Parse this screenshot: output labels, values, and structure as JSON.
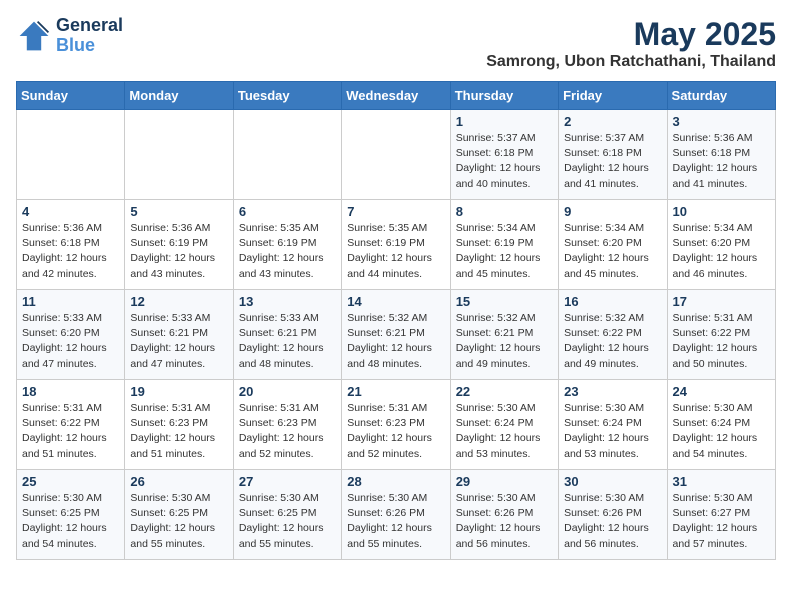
{
  "header": {
    "logo_line1": "General",
    "logo_line2": "Blue",
    "title": "May 2025",
    "subtitle": "Samrong, Ubon Ratchathani, Thailand"
  },
  "days_of_week": [
    "Sunday",
    "Monday",
    "Tuesday",
    "Wednesday",
    "Thursday",
    "Friday",
    "Saturday"
  ],
  "weeks": [
    [
      {
        "day": "",
        "info": ""
      },
      {
        "day": "",
        "info": ""
      },
      {
        "day": "",
        "info": ""
      },
      {
        "day": "",
        "info": ""
      },
      {
        "day": "1",
        "info": "Sunrise: 5:37 AM\nSunset: 6:18 PM\nDaylight: 12 hours\nand 40 minutes."
      },
      {
        "day": "2",
        "info": "Sunrise: 5:37 AM\nSunset: 6:18 PM\nDaylight: 12 hours\nand 41 minutes."
      },
      {
        "day": "3",
        "info": "Sunrise: 5:36 AM\nSunset: 6:18 PM\nDaylight: 12 hours\nand 41 minutes."
      }
    ],
    [
      {
        "day": "4",
        "info": "Sunrise: 5:36 AM\nSunset: 6:18 PM\nDaylight: 12 hours\nand 42 minutes."
      },
      {
        "day": "5",
        "info": "Sunrise: 5:36 AM\nSunset: 6:19 PM\nDaylight: 12 hours\nand 43 minutes."
      },
      {
        "day": "6",
        "info": "Sunrise: 5:35 AM\nSunset: 6:19 PM\nDaylight: 12 hours\nand 43 minutes."
      },
      {
        "day": "7",
        "info": "Sunrise: 5:35 AM\nSunset: 6:19 PM\nDaylight: 12 hours\nand 44 minutes."
      },
      {
        "day": "8",
        "info": "Sunrise: 5:34 AM\nSunset: 6:19 PM\nDaylight: 12 hours\nand 45 minutes."
      },
      {
        "day": "9",
        "info": "Sunrise: 5:34 AM\nSunset: 6:20 PM\nDaylight: 12 hours\nand 45 minutes."
      },
      {
        "day": "10",
        "info": "Sunrise: 5:34 AM\nSunset: 6:20 PM\nDaylight: 12 hours\nand 46 minutes."
      }
    ],
    [
      {
        "day": "11",
        "info": "Sunrise: 5:33 AM\nSunset: 6:20 PM\nDaylight: 12 hours\nand 47 minutes."
      },
      {
        "day": "12",
        "info": "Sunrise: 5:33 AM\nSunset: 6:21 PM\nDaylight: 12 hours\nand 47 minutes."
      },
      {
        "day": "13",
        "info": "Sunrise: 5:33 AM\nSunset: 6:21 PM\nDaylight: 12 hours\nand 48 minutes."
      },
      {
        "day": "14",
        "info": "Sunrise: 5:32 AM\nSunset: 6:21 PM\nDaylight: 12 hours\nand 48 minutes."
      },
      {
        "day": "15",
        "info": "Sunrise: 5:32 AM\nSunset: 6:21 PM\nDaylight: 12 hours\nand 49 minutes."
      },
      {
        "day": "16",
        "info": "Sunrise: 5:32 AM\nSunset: 6:22 PM\nDaylight: 12 hours\nand 49 minutes."
      },
      {
        "day": "17",
        "info": "Sunrise: 5:31 AM\nSunset: 6:22 PM\nDaylight: 12 hours\nand 50 minutes."
      }
    ],
    [
      {
        "day": "18",
        "info": "Sunrise: 5:31 AM\nSunset: 6:22 PM\nDaylight: 12 hours\nand 51 minutes."
      },
      {
        "day": "19",
        "info": "Sunrise: 5:31 AM\nSunset: 6:23 PM\nDaylight: 12 hours\nand 51 minutes."
      },
      {
        "day": "20",
        "info": "Sunrise: 5:31 AM\nSunset: 6:23 PM\nDaylight: 12 hours\nand 52 minutes."
      },
      {
        "day": "21",
        "info": "Sunrise: 5:31 AM\nSunset: 6:23 PM\nDaylight: 12 hours\nand 52 minutes."
      },
      {
        "day": "22",
        "info": "Sunrise: 5:30 AM\nSunset: 6:24 PM\nDaylight: 12 hours\nand 53 minutes."
      },
      {
        "day": "23",
        "info": "Sunrise: 5:30 AM\nSunset: 6:24 PM\nDaylight: 12 hours\nand 53 minutes."
      },
      {
        "day": "24",
        "info": "Sunrise: 5:30 AM\nSunset: 6:24 PM\nDaylight: 12 hours\nand 54 minutes."
      }
    ],
    [
      {
        "day": "25",
        "info": "Sunrise: 5:30 AM\nSunset: 6:25 PM\nDaylight: 12 hours\nand 54 minutes."
      },
      {
        "day": "26",
        "info": "Sunrise: 5:30 AM\nSunset: 6:25 PM\nDaylight: 12 hours\nand 55 minutes."
      },
      {
        "day": "27",
        "info": "Sunrise: 5:30 AM\nSunset: 6:25 PM\nDaylight: 12 hours\nand 55 minutes."
      },
      {
        "day": "28",
        "info": "Sunrise: 5:30 AM\nSunset: 6:26 PM\nDaylight: 12 hours\nand 55 minutes."
      },
      {
        "day": "29",
        "info": "Sunrise: 5:30 AM\nSunset: 6:26 PM\nDaylight: 12 hours\nand 56 minutes."
      },
      {
        "day": "30",
        "info": "Sunrise: 5:30 AM\nSunset: 6:26 PM\nDaylight: 12 hours\nand 56 minutes."
      },
      {
        "day": "31",
        "info": "Sunrise: 5:30 AM\nSunset: 6:27 PM\nDaylight: 12 hours\nand 57 minutes."
      }
    ]
  ]
}
